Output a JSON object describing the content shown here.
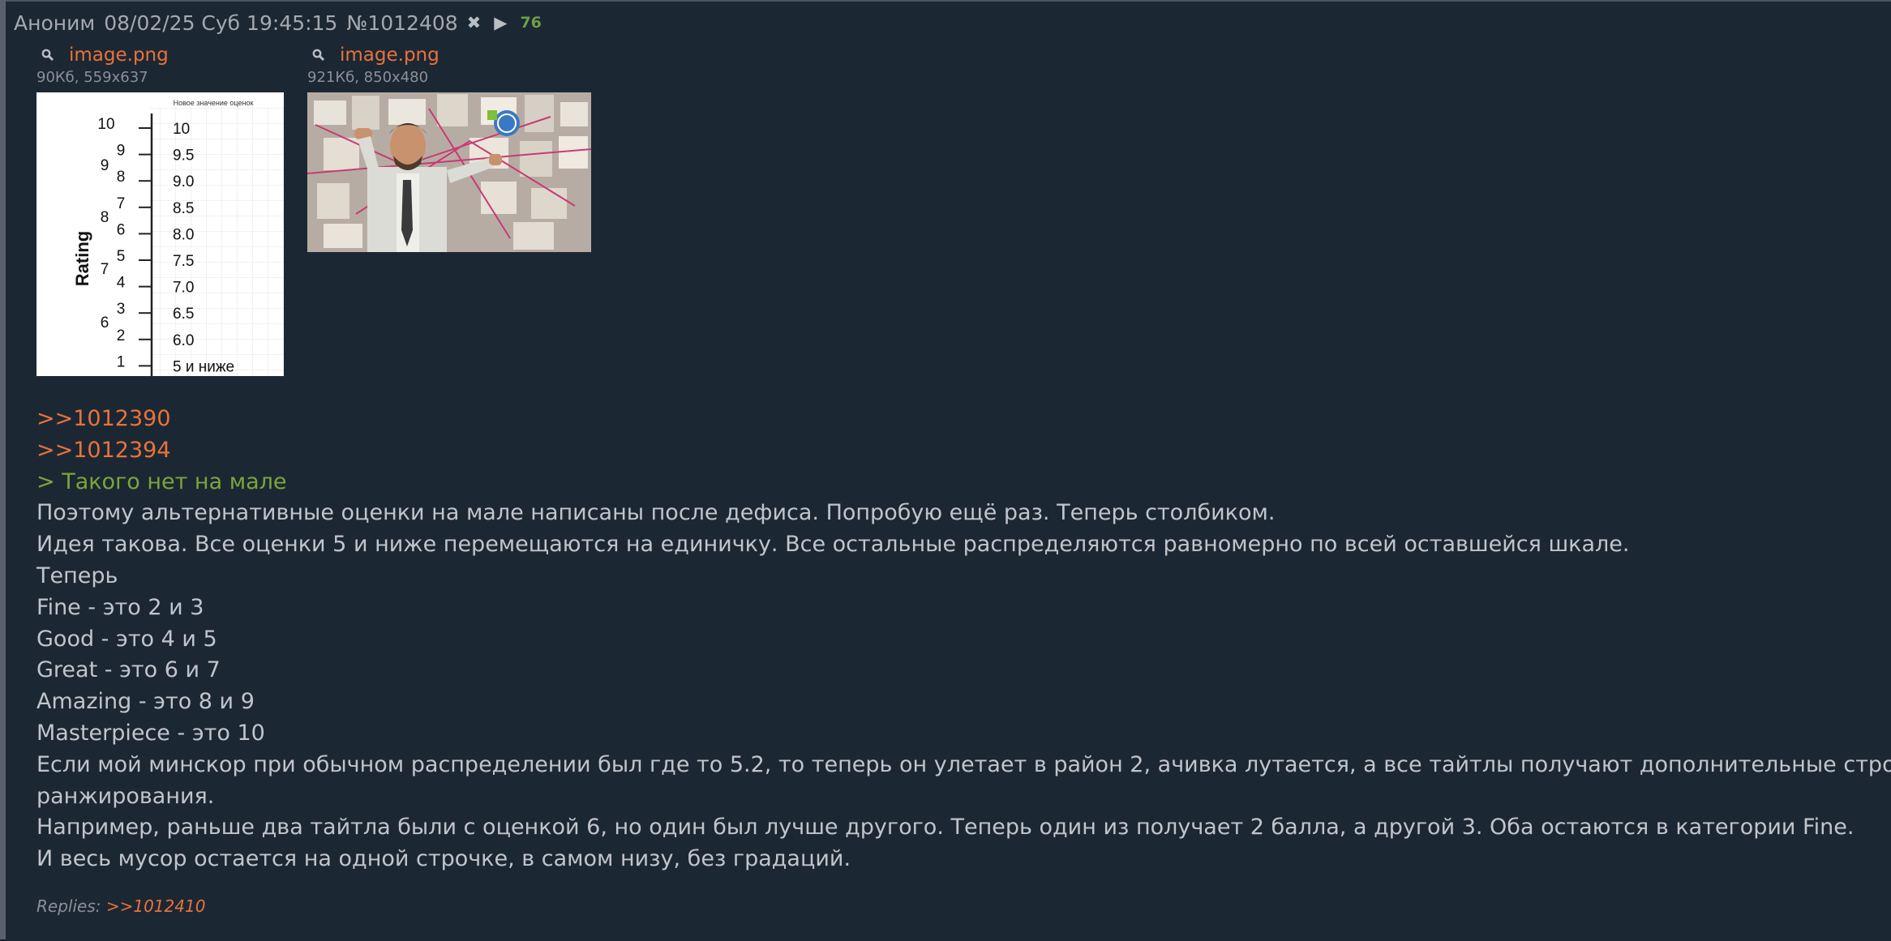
{
  "header": {
    "author": "Аноним",
    "datetime": "08/02/25 Суб 19:45:15",
    "post_number": "№1012408",
    "reply_count": "76"
  },
  "files": [
    {
      "name": "image.png",
      "meta": "90Кб, 559x637",
      "scale_chart": {
        "header": "Новое значение оценок",
        "axis_label": "Rating",
        "left_numbers": [
          "10",
          "9",
          "8",
          "7",
          "6",
          "5",
          "4",
          "3",
          "2",
          "1"
        ],
        "group_numbers": [
          "9",
          "8",
          "7",
          "6"
        ],
        "right_values": [
          "10",
          "9.5",
          "9.0",
          "8.5",
          "8.0",
          "7.5",
          "7.0",
          "6.5",
          "6.0",
          "5 и ниже"
        ]
      }
    },
    {
      "name": "image.png",
      "meta": "921Кб, 850x480"
    }
  ],
  "body": {
    "links": [
      ">>1012390",
      ">>1012394"
    ],
    "quote": "> Такого нет на мале",
    "lines": [
      "Поэтому альтернативные оценки на мале написаны после дефиса. Попробую ещё раз. Теперь столбиком.",
      "Идея такова. Все оценки 5 и ниже перемещаются на единичку. Все остальные распределяются равномерно по всей оставшейся шкале.",
      "Теперь",
      "Fine - это 2 и 3",
      "Good - это 4 и 5",
      "Great - это 6 и 7",
      "Amazing - это 8 и 9",
      "Masterpiece - это 10",
      "Если мой минскор при обычном распределении был где то 5.2, то теперь он улетает в район 2, ачивка лутается, а все тайтлы получают дополнительные строчки для",
      "ранжирования.",
      "Например, раньше два тайтла были с оценкой 6, но один был лучше другого. Теперь один из получает 2 балла, а другой 3. Оба остаются в категории Fine.",
      "И весь мусор остается на одной строчке, в самом низу, без градаций."
    ]
  },
  "replies": {
    "label": "Replies:",
    "link": ">>1012410"
  }
}
